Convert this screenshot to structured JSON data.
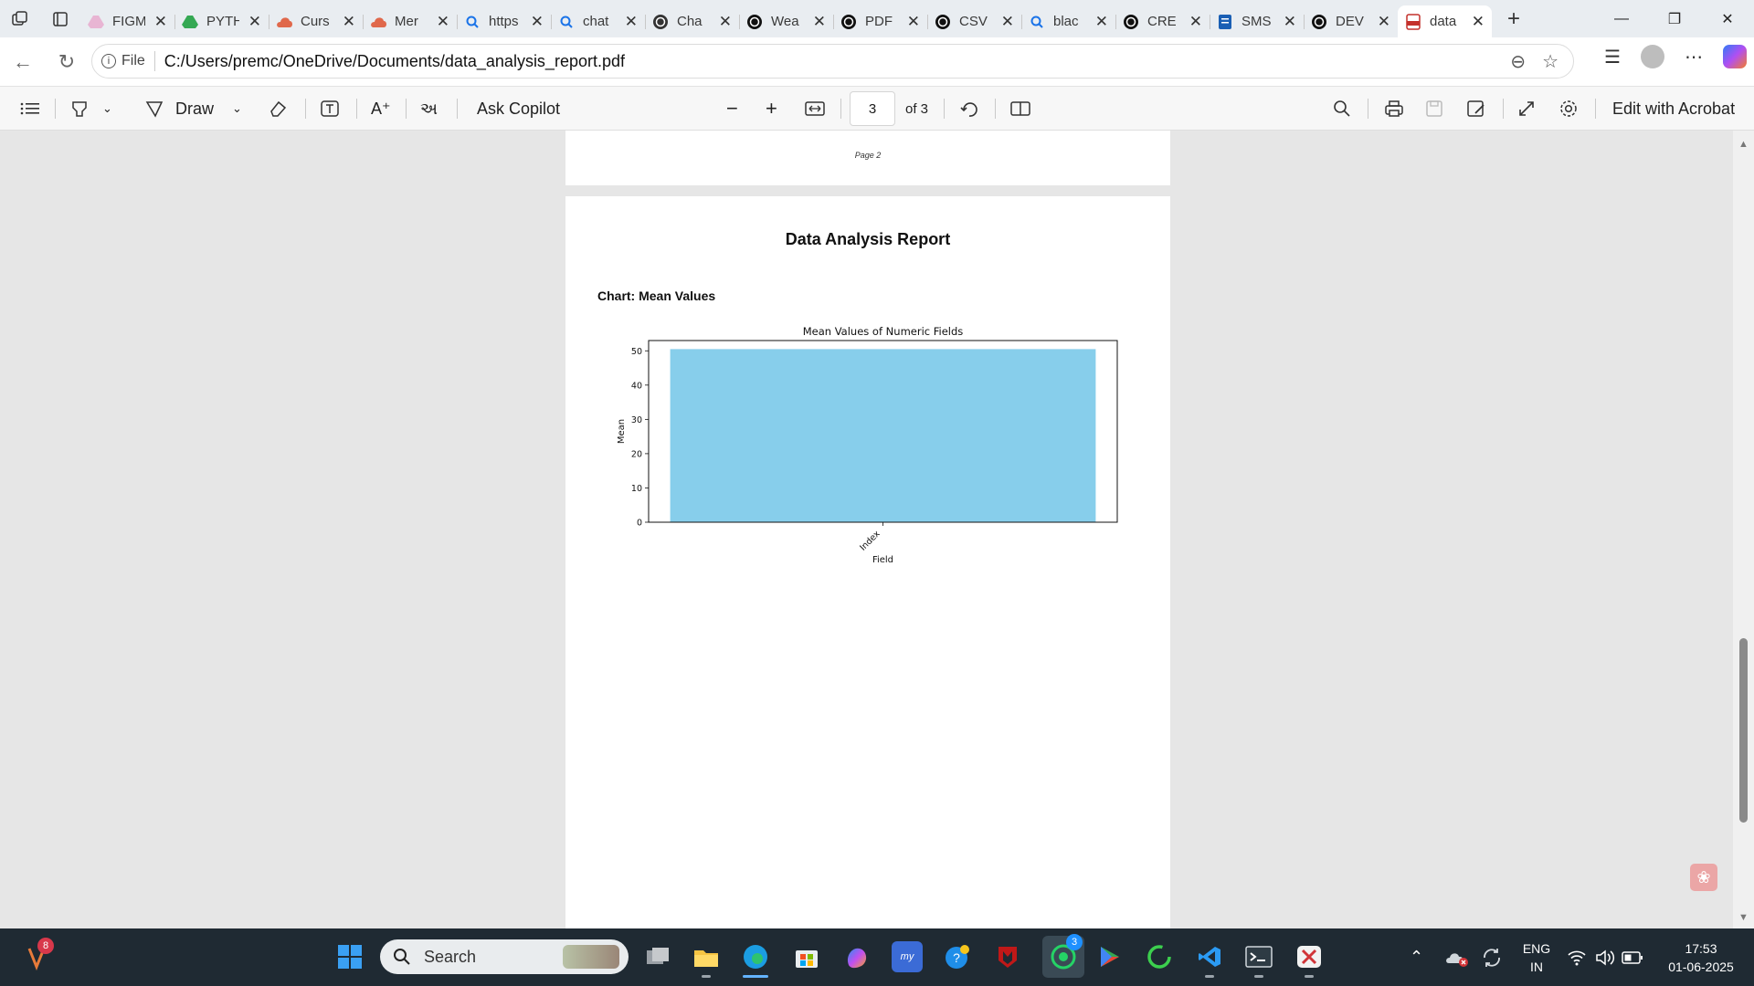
{
  "browser": {
    "tabs": [
      {
        "title": "FIGM",
        "icon": "google-drive-icon",
        "color": "#e8b5d3"
      },
      {
        "title": "PYTH",
        "icon": "google-drive-icon",
        "color": "#34a853"
      },
      {
        "title": "Curs",
        "icon": "cloud-icon",
        "color": "#e0684b"
      },
      {
        "title": "Mer",
        "icon": "cloud-icon",
        "color": "#e0684b"
      },
      {
        "title": "https",
        "icon": "search-icon",
        "color": "#1a73e8"
      },
      {
        "title": "chat",
        "icon": "search-icon",
        "color": "#1a73e8"
      },
      {
        "title": "Cha",
        "icon": "openai-icon",
        "color": "#333333"
      },
      {
        "title": "Wea",
        "icon": "openai-icon",
        "color": "#111111"
      },
      {
        "title": "PDF",
        "icon": "openai-icon",
        "color": "#111111"
      },
      {
        "title": "CSV",
        "icon": "openai-icon",
        "color": "#111111"
      },
      {
        "title": "blac",
        "icon": "search-icon",
        "color": "#1a73e8"
      },
      {
        "title": "CRE",
        "icon": "openai-icon",
        "color": "#111111"
      },
      {
        "title": "SMS",
        "icon": "doc-icon",
        "color": "#1a5fb4"
      },
      {
        "title": "DEV",
        "icon": "openai-icon",
        "color": "#111111"
      },
      {
        "title": "data",
        "icon": "pdf-icon",
        "color": "#c4302b"
      }
    ],
    "address": {
      "scheme_label": "File",
      "url": "C:/Users/premc/OneDrive/Documents/data_analysis_report.pdf"
    }
  },
  "pdf_toolbar": {
    "draw_label": "Draw",
    "ask_copilot_label": "Ask Copilot",
    "page_current": "3",
    "page_total_label": "of 3",
    "edit_label": "Edit with Acrobat"
  },
  "document": {
    "prev_page_footer": "Page 2",
    "report_title": "Data Analysis Report",
    "chart_heading": "Chart: Mean Values"
  },
  "chart_data": {
    "type": "bar",
    "title": "Mean Values of Numeric Fields",
    "xlabel": "Field",
    "ylabel": "Mean",
    "categories": [
      "Index"
    ],
    "values": [
      50.5
    ],
    "ylim": [
      0,
      53
    ],
    "yticks": [
      0,
      10,
      20,
      30,
      40,
      50
    ],
    "bar_color": "#87ceeb",
    "grid": false
  },
  "taskbar": {
    "search_placeholder": "Search",
    "notif_badge": "8",
    "whatsapp_badge": "3",
    "language": "ENG",
    "region": "IN",
    "time": "17:53",
    "date": "01-06-2025"
  }
}
